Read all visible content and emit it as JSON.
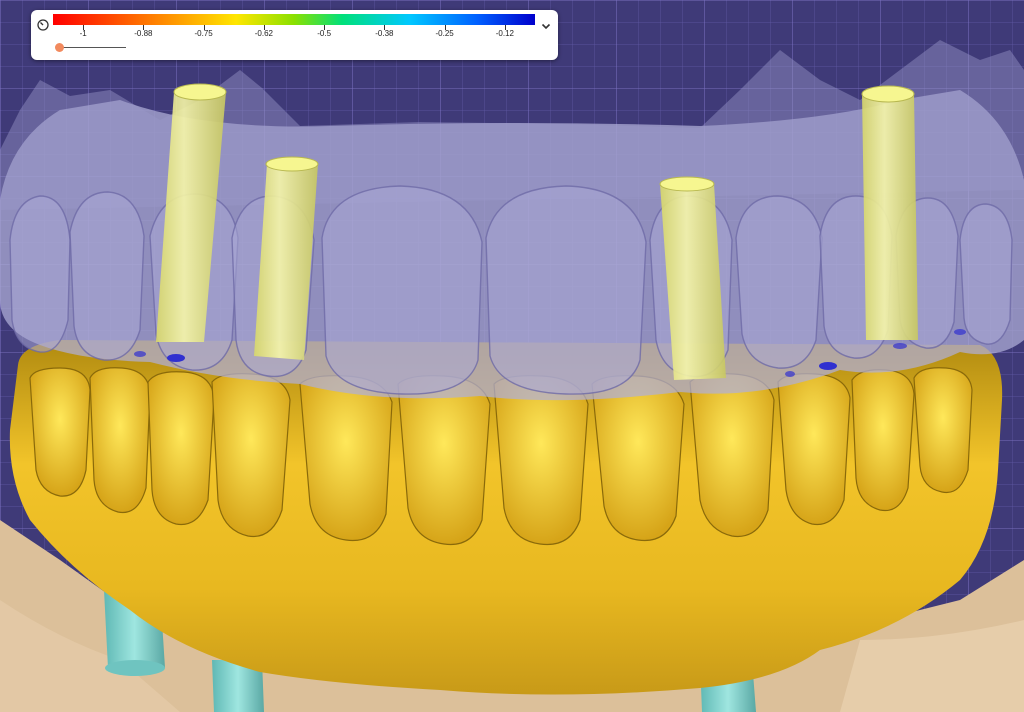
{
  "legend": {
    "ticks": [
      "-1",
      "-0.88",
      "-0.75",
      "-0.62",
      "-0.5",
      "-0.38",
      "-0.25",
      "-0.12"
    ],
    "gradient_colors": [
      "#ff0000",
      "#ff7a00",
      "#ffe600",
      "#8ae000",
      "#00e07a",
      "#00c8ff",
      "#0060ff",
      "#0000cc"
    ],
    "slider_level": 0
  },
  "icons": {
    "gauge": "gauge-icon",
    "collapse": "chevron-down-icon"
  },
  "scene": {
    "background_color": "#3f3a78",
    "grid_color": "#7a6fc8",
    "gum_color": "#e8b820",
    "bridge_color": "#b0aed8",
    "implant_color": "#f2f280",
    "abutment_color": "#7fd0cc",
    "model_color": "#dcc09a"
  }
}
